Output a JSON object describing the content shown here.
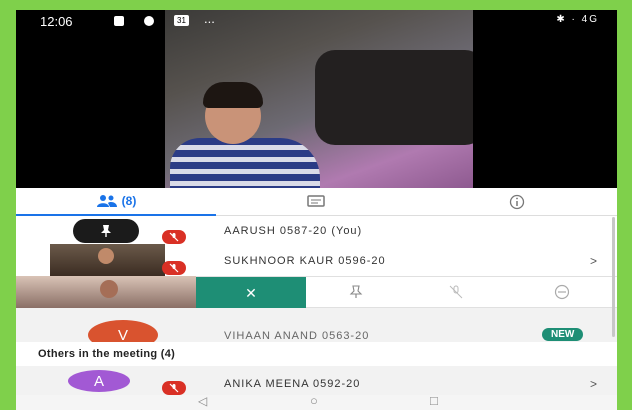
{
  "status_bar": {
    "time": "12:06",
    "badge": "31",
    "dots": "...",
    "right": "✱ · 4G"
  },
  "tabs": [
    {
      "name": "people",
      "label": "(8)",
      "icon": "people-icon",
      "active": true
    },
    {
      "name": "chat",
      "label": "",
      "icon": "chat-icon",
      "active": false
    },
    {
      "name": "info",
      "label": "",
      "icon": "info-icon",
      "active": false
    }
  ],
  "participants": [
    {
      "name": "AARUSH 0587-20 (You)",
      "chevron": ""
    },
    {
      "name": "SUKHNOOR KAUR 0596-20",
      "chevron": ">"
    },
    {
      "name": "VIHAAN ANAND 0563-20",
      "avatar": "V",
      "badge": "NEW"
    }
  ],
  "others": {
    "heading": "Others in the meeting (4)",
    "items": [
      {
        "name": "ANIKA MEENA 0592-20",
        "avatar": "A",
        "chevron": ">"
      }
    ]
  },
  "actions": [
    {
      "name": "close",
      "symbol": "✕"
    },
    {
      "name": "pin",
      "symbol": "pin-icon"
    },
    {
      "name": "mute",
      "symbol": "mic-off-icon"
    },
    {
      "name": "remove",
      "symbol": "remove-icon"
    }
  ],
  "colors": {
    "accent": "#1a73e8",
    "teal": "#1e8e75",
    "mute_red": "#d93025",
    "avatar_v": "#d9532f",
    "avatar_a": "#a259d4",
    "frame": "#7fd04b"
  },
  "nav": {
    "back": "◁",
    "home": "○",
    "recent": "□"
  }
}
